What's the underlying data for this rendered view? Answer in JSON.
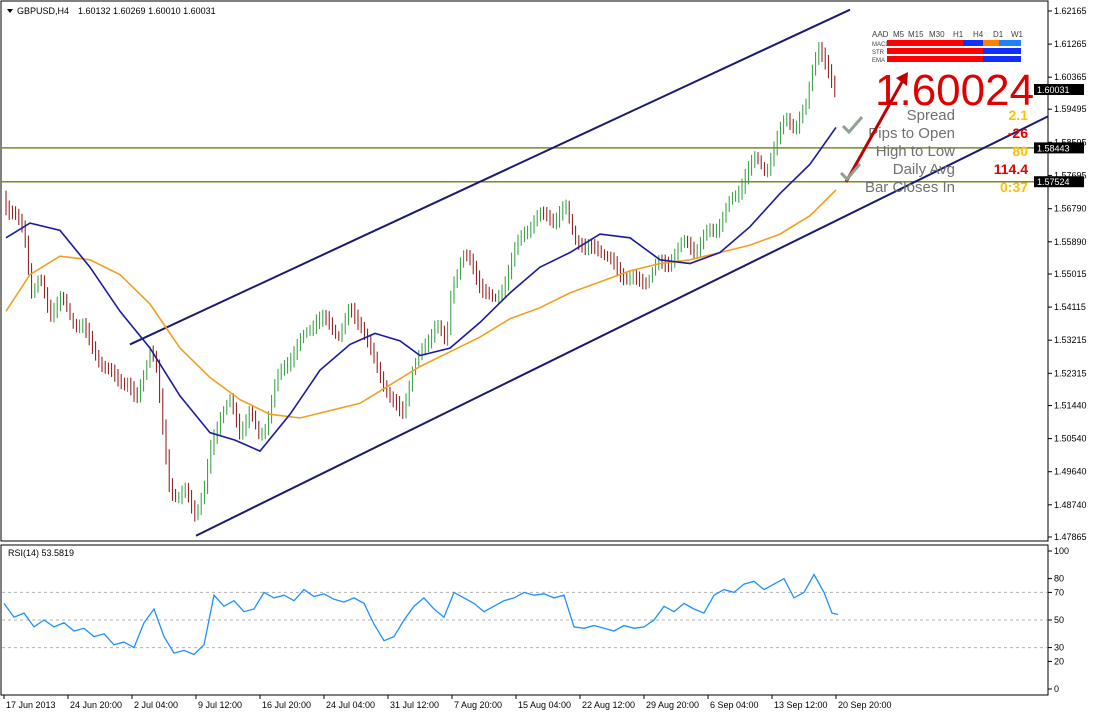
{
  "header": {
    "symbol_label": "GBPUSD,H4",
    "ohlc": "1.60132 1.60269 1.60010 1.60031"
  },
  "rsi_header": "RSI(14) 53.5819",
  "price_axis": [
    "1.62165",
    "1.61265",
    "1.60365",
    "1.59495",
    "1.58595",
    "1.57695",
    "1.56790",
    "1.55890",
    "1.55015",
    "1.54115",
    "1.53215",
    "1.52315",
    "1.51440",
    "1.50540",
    "1.49640",
    "1.48740",
    "1.47865"
  ],
  "rsi_axis": [
    "100",
    "80",
    "70",
    "50",
    "30",
    "20",
    "0"
  ],
  "time_axis": [
    "17 Jun 2013",
    "24 Jun 20:00",
    "2 Jul 04:00",
    "9 Jul 12:00",
    "16 Jul 20:00",
    "24 Jul 04:00",
    "31 Jul 12:00",
    "7 Aug 20:00",
    "15 Aug 04:00",
    "22 Aug 12:00",
    "29 Aug 20:00",
    "6 Sep 04:00",
    "13 Sep 12:00",
    "20 Sep 20:00"
  ],
  "current_price_tag": "1.60031",
  "hlines": [
    {
      "price": 1.58443,
      "label": "1.58443"
    },
    {
      "price": 1.57524,
      "label": "1.57524"
    }
  ],
  "panel": {
    "big_price": "1.60024",
    "stats": [
      {
        "label": "Spread",
        "value": "2.1",
        "color": "#ffc000"
      },
      {
        "label": "Pips to Open",
        "value": "-26",
        "color": "#e00000"
      },
      {
        "label": "High to Low",
        "value": "80",
        "color": "#ffc000"
      },
      {
        "label": "Daily Avg",
        "value": "114.4",
        "color": "#e00000"
      },
      {
        "label": "Bar Closes In",
        "value": "0:37",
        "color": "#ffc000"
      }
    ],
    "mtf": {
      "title": "AAD",
      "timeframes": [
        "M5",
        "M15",
        "M30",
        "H1",
        "H4",
        "D1",
        "W1"
      ],
      "rows": [
        {
          "label": "MACD",
          "colors": [
            "#ff0000",
            "#ff0000",
            "#ff0000",
            "#ff0000",
            "#1030ff",
            "#ff8000",
            "#2080ff"
          ]
        },
        {
          "label": "STR",
          "colors": [
            "#ff0000",
            "#ff0000",
            "#ff0000",
            "#ff0000",
            "#ff0000",
            "#1030ff",
            "#1030ff"
          ]
        },
        {
          "label": "EMA",
          "colors": [
            "#ff0000",
            "#ff0000",
            "#ff0000",
            "#ff0000",
            "#ff0000",
            "#1030ff",
            "#1030ff"
          ]
        }
      ]
    }
  },
  "chart_data": {
    "type": "candlestick",
    "symbol": "GBPUSD",
    "timeframe": "H4",
    "ylim": [
      1.47865,
      1.62165
    ],
    "rsi_ylim": [
      0,
      100
    ],
    "rsi_levels": [
      30,
      50,
      70
    ],
    "close_path": [
      [
        0,
        1.575
      ],
      [
        8,
        1.567
      ],
      [
        14,
        1.565
      ],
      [
        24,
        1.563
      ],
      [
        32,
        1.545
      ],
      [
        40,
        1.548
      ],
      [
        50,
        1.54
      ],
      [
        62,
        1.543
      ],
      [
        72,
        1.538
      ],
      [
        82,
        1.536
      ],
      [
        92,
        1.53
      ],
      [
        104,
        1.525
      ],
      [
        116,
        1.522
      ],
      [
        128,
        1.52
      ],
      [
        136,
        1.515
      ],
      [
        144,
        1.524
      ],
      [
        150,
        1.53
      ],
      [
        156,
        1.525
      ],
      [
        162,
        1.51
      ],
      [
        170,
        1.492
      ],
      [
        178,
        1.488
      ],
      [
        186,
        1.492
      ],
      [
        196,
        1.485
      ],
      [
        204,
        1.49
      ],
      [
        212,
        1.505
      ],
      [
        220,
        1.512
      ],
      [
        230,
        1.515
      ],
      [
        240,
        1.508
      ],
      [
        250,
        1.512
      ],
      [
        258,
        1.506
      ],
      [
        266,
        1.51
      ],
      [
        276,
        1.52
      ],
      [
        286,
        1.526
      ],
      [
        296,
        1.53
      ],
      [
        306,
        1.534
      ],
      [
        316,
        1.538
      ],
      [
        326,
        1.537
      ],
      [
        338,
        1.534
      ],
      [
        350,
        1.54
      ],
      [
        362,
        1.536
      ],
      [
        372,
        1.528
      ],
      [
        382,
        1.522
      ],
      [
        392,
        1.515
      ],
      [
        402,
        1.512
      ],
      [
        412,
        1.524
      ],
      [
        424,
        1.53
      ],
      [
        436,
        1.537
      ],
      [
        446,
        1.53
      ],
      [
        452,
        1.548
      ],
      [
        462,
        1.555
      ],
      [
        472,
        1.552
      ],
      [
        484,
        1.546
      ],
      [
        494,
        1.542
      ],
      [
        504,
        1.548
      ],
      [
        514,
        1.555
      ],
      [
        524,
        1.562
      ],
      [
        534,
        1.565
      ],
      [
        546,
        1.566
      ],
      [
        556,
        1.565
      ],
      [
        566,
        1.568
      ],
      [
        576,
        1.56
      ],
      [
        586,
        1.556
      ],
      [
        596,
        1.558
      ],
      [
        606,
        1.555
      ],
      [
        616,
        1.552
      ],
      [
        626,
        1.549
      ],
      [
        636,
        1.548
      ],
      [
        646,
        1.549
      ],
      [
        656,
        1.552
      ],
      [
        666,
        1.553
      ],
      [
        676,
        1.556
      ],
      [
        686,
        1.559
      ],
      [
        696,
        1.557
      ],
      [
        706,
        1.56
      ],
      [
        716,
        1.563
      ],
      [
        726,
        1.568
      ],
      [
        736,
        1.571
      ],
      [
        746,
        1.578
      ],
      [
        756,
        1.581
      ],
      [
        766,
        1.579
      ],
      [
        776,
        1.585
      ],
      [
        786,
        1.593
      ],
      [
        796,
        1.59
      ],
      [
        806,
        1.596
      ],
      [
        812,
        1.606
      ],
      [
        818,
        1.612
      ],
      [
        826,
        1.606
      ],
      [
        836,
        1.6
      ]
    ],
    "ma_fast": [
      [
        6,
        1.56
      ],
      [
        30,
        1.564
      ],
      [
        60,
        1.562
      ],
      [
        90,
        1.552
      ],
      [
        120,
        1.54
      ],
      [
        150,
        1.53
      ],
      [
        180,
        1.517
      ],
      [
        210,
        1.507
      ],
      [
        235,
        1.505
      ],
      [
        260,
        1.502
      ],
      [
        290,
        1.512
      ],
      [
        320,
        1.524
      ],
      [
        350,
        1.531
      ],
      [
        375,
        1.534
      ],
      [
        400,
        1.532
      ],
      [
        420,
        1.528
      ],
      [
        450,
        1.53
      ],
      [
        480,
        1.537
      ],
      [
        510,
        1.545
      ],
      [
        540,
        1.552
      ],
      [
        570,
        1.556
      ],
      [
        600,
        1.561
      ],
      [
        630,
        1.56
      ],
      [
        660,
        1.554
      ],
      [
        690,
        1.553
      ],
      [
        720,
        1.556
      ],
      [
        750,
        1.563
      ],
      [
        780,
        1.572
      ],
      [
        810,
        1.58
      ],
      [
        836,
        1.59
      ]
    ],
    "ma_slow": [
      [
        6,
        1.54
      ],
      [
        30,
        1.55
      ],
      [
        60,
        1.555
      ],
      [
        90,
        1.554
      ],
      [
        120,
        1.55
      ],
      [
        150,
        1.542
      ],
      [
        180,
        1.53
      ],
      [
        210,
        1.522
      ],
      [
        240,
        1.516
      ],
      [
        270,
        1.512
      ],
      [
        300,
        1.511
      ],
      [
        330,
        1.513
      ],
      [
        360,
        1.515
      ],
      [
        390,
        1.52
      ],
      [
        420,
        1.525
      ],
      [
        450,
        1.529
      ],
      [
        480,
        1.533
      ],
      [
        510,
        1.538
      ],
      [
        540,
        1.541
      ],
      [
        570,
        1.545
      ],
      [
        600,
        1.548
      ],
      [
        630,
        1.551
      ],
      [
        660,
        1.553
      ],
      [
        690,
        1.554
      ],
      [
        720,
        1.556
      ],
      [
        750,
        1.558
      ],
      [
        780,
        1.561
      ],
      [
        810,
        1.566
      ],
      [
        836,
        1.573
      ]
    ],
    "channel_upper": [
      [
        130,
        1.531
      ],
      [
        850,
        1.622
      ]
    ],
    "channel_lower": [
      [
        196,
        1.479
      ],
      [
        1048,
        1.593
      ]
    ],
    "rsi_path": [
      [
        4,
        62
      ],
      [
        14,
        52
      ],
      [
        24,
        55
      ],
      [
        34,
        45
      ],
      [
        44,
        50
      ],
      [
        54,
        45
      ],
      [
        64,
        48
      ],
      [
        74,
        42
      ],
      [
        84,
        44
      ],
      [
        94,
        38
      ],
      [
        104,
        40
      ],
      [
        114,
        32
      ],
      [
        124,
        34
      ],
      [
        134,
        30
      ],
      [
        144,
        48
      ],
      [
        154,
        58
      ],
      [
        164,
        38
      ],
      [
        174,
        26
      ],
      [
        184,
        28
      ],
      [
        194,
        25
      ],
      [
        204,
        32
      ],
      [
        214,
        68
      ],
      [
        224,
        60
      ],
      [
        234,
        64
      ],
      [
        244,
        56
      ],
      [
        254,
        58
      ],
      [
        264,
        70
      ],
      [
        274,
        66
      ],
      [
        284,
        68
      ],
      [
        294,
        64
      ],
      [
        304,
        72
      ],
      [
        314,
        67
      ],
      [
        324,
        69
      ],
      [
        334,
        65
      ],
      [
        344,
        63
      ],
      [
        354,
        66
      ],
      [
        364,
        62
      ],
      [
        374,
        47
      ],
      [
        384,
        35
      ],
      [
        394,
        38
      ],
      [
        404,
        50
      ],
      [
        414,
        60
      ],
      [
        424,
        66
      ],
      [
        434,
        58
      ],
      [
        444,
        52
      ],
      [
        454,
        70
      ],
      [
        464,
        66
      ],
      [
        474,
        62
      ],
      [
        484,
        56
      ],
      [
        494,
        60
      ],
      [
        504,
        64
      ],
      [
        514,
        66
      ],
      [
        524,
        70
      ],
      [
        534,
        68
      ],
      [
        544,
        69
      ],
      [
        554,
        66
      ],
      [
        564,
        68
      ],
      [
        574,
        45
      ],
      [
        584,
        44
      ],
      [
        594,
        46
      ],
      [
        604,
        44
      ],
      [
        614,
        42
      ],
      [
        624,
        46
      ],
      [
        634,
        44
      ],
      [
        644,
        45
      ],
      [
        654,
        50
      ],
      [
        664,
        60
      ],
      [
        674,
        56
      ],
      [
        684,
        62
      ],
      [
        694,
        58
      ],
      [
        704,
        55
      ],
      [
        714,
        68
      ],
      [
        724,
        72
      ],
      [
        734,
        70
      ],
      [
        744,
        76
      ],
      [
        754,
        78
      ],
      [
        764,
        72
      ],
      [
        774,
        76
      ],
      [
        784,
        80
      ],
      [
        794,
        66
      ],
      [
        804,
        70
      ],
      [
        814,
        83
      ],
      [
        824,
        70
      ],
      [
        832,
        55
      ],
      [
        838,
        54
      ]
    ]
  }
}
